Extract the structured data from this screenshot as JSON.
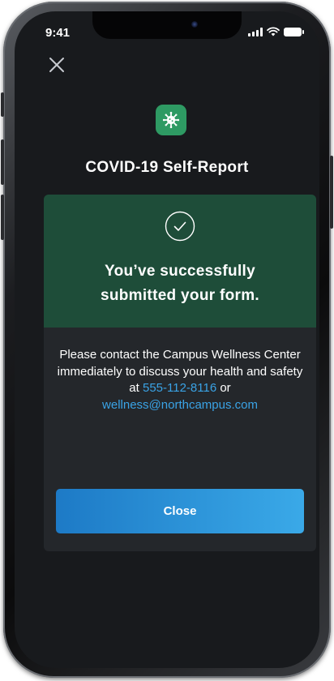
{
  "status_bar": {
    "time": "9:41",
    "icons": [
      "signal-icon",
      "wifi-icon",
      "battery-icon"
    ]
  },
  "header": {
    "close_icon": "close-icon",
    "app_icon": "virus-icon",
    "title": "COVID-19 Self-Report"
  },
  "success": {
    "icon": "check-circle-icon",
    "line1": "You’ve successfully",
    "line2": "submitted your form."
  },
  "message": {
    "text_before": "Please contact the Campus Wellness Center immediately to discuss your health and safety at ",
    "phone": "555-112-8116",
    "text_between": " or ",
    "email": "wellness@northcampus.com"
  },
  "actions": {
    "close_label": "Close"
  },
  "colors": {
    "screen_background": "#181a1d",
    "card_background": "#24272b",
    "success_background": "#1e4d39",
    "app_icon_green": "#2e9a63",
    "link_blue": "#3aa3e6",
    "button_gradient_start": "#1d7ac6",
    "button_gradient_end": "#3aa9e8"
  }
}
